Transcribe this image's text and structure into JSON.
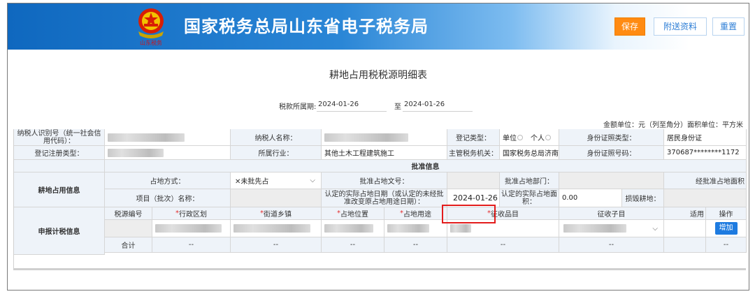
{
  "header": {
    "title": "国家税务总局山东省电子税务局",
    "emblem_caption": "山东税务",
    "buttons": {
      "save": "保存",
      "attach": "附送资料",
      "reset": "重置"
    },
    "colors": {
      "banner": "#1a74c9",
      "save": "#ff8b12",
      "link": "#2f7fd6"
    }
  },
  "form": {
    "title": "耕地占用税税源明细表",
    "period_label": "税款所属期:",
    "period_from": "2024-01-26",
    "period_to_label": "至",
    "period_to": "2024-01-26",
    "units": "金额单位：元（列至角分）面积单位：平方米"
  },
  "taxpayer": {
    "id_label": "纳税人识别号（统一社会信用代码）：",
    "name_label": "纳税人名称：",
    "reg_type_label": "登记类型：",
    "reg_type_options": [
      "单位",
      "个人"
    ],
    "id_type_label": "身份证照类型：",
    "id_type_value": "居民身份证",
    "reg_category_label": "登记注册类型：",
    "industry_label": "所属行业：",
    "industry_value": "其他土木工程建筑施工",
    "authority_label": "主管税务机关：",
    "authority_value": "国家税务总局济南市",
    "id_number_label": "身份证照号码：",
    "id_number_value": "370687********1172"
  },
  "approval": {
    "section_label": "批准信息",
    "group_label": "耕地占用信息",
    "occupy_method_label": "占地方式：",
    "occupy_method_value": "未批先占",
    "doc_no_label": "批准占地文号：",
    "dept_label": "批准占地部门：",
    "area_label": "经批准占地面积",
    "project_label": "项目（批次）名称：",
    "actual_date_label": "认定的实际占地日期（或认定的未经批准改变原占地用途日期）：",
    "actual_date_value": "2024-01-26",
    "actual_area_label": "认定的实际占地面积：",
    "actual_area_value": "0.00",
    "damaged_label": "损毁耕地："
  },
  "tax_info": {
    "group_label": "申报计税信息",
    "columns": [
      "税源编号",
      "行政区划",
      "街道乡镇",
      "占地位置",
      "占地用途",
      "征收品目",
      "征收子目",
      "适用",
      "操作"
    ],
    "required_prefix": "*",
    "add_button": "增加",
    "total_label": "合计",
    "dash": "--"
  }
}
